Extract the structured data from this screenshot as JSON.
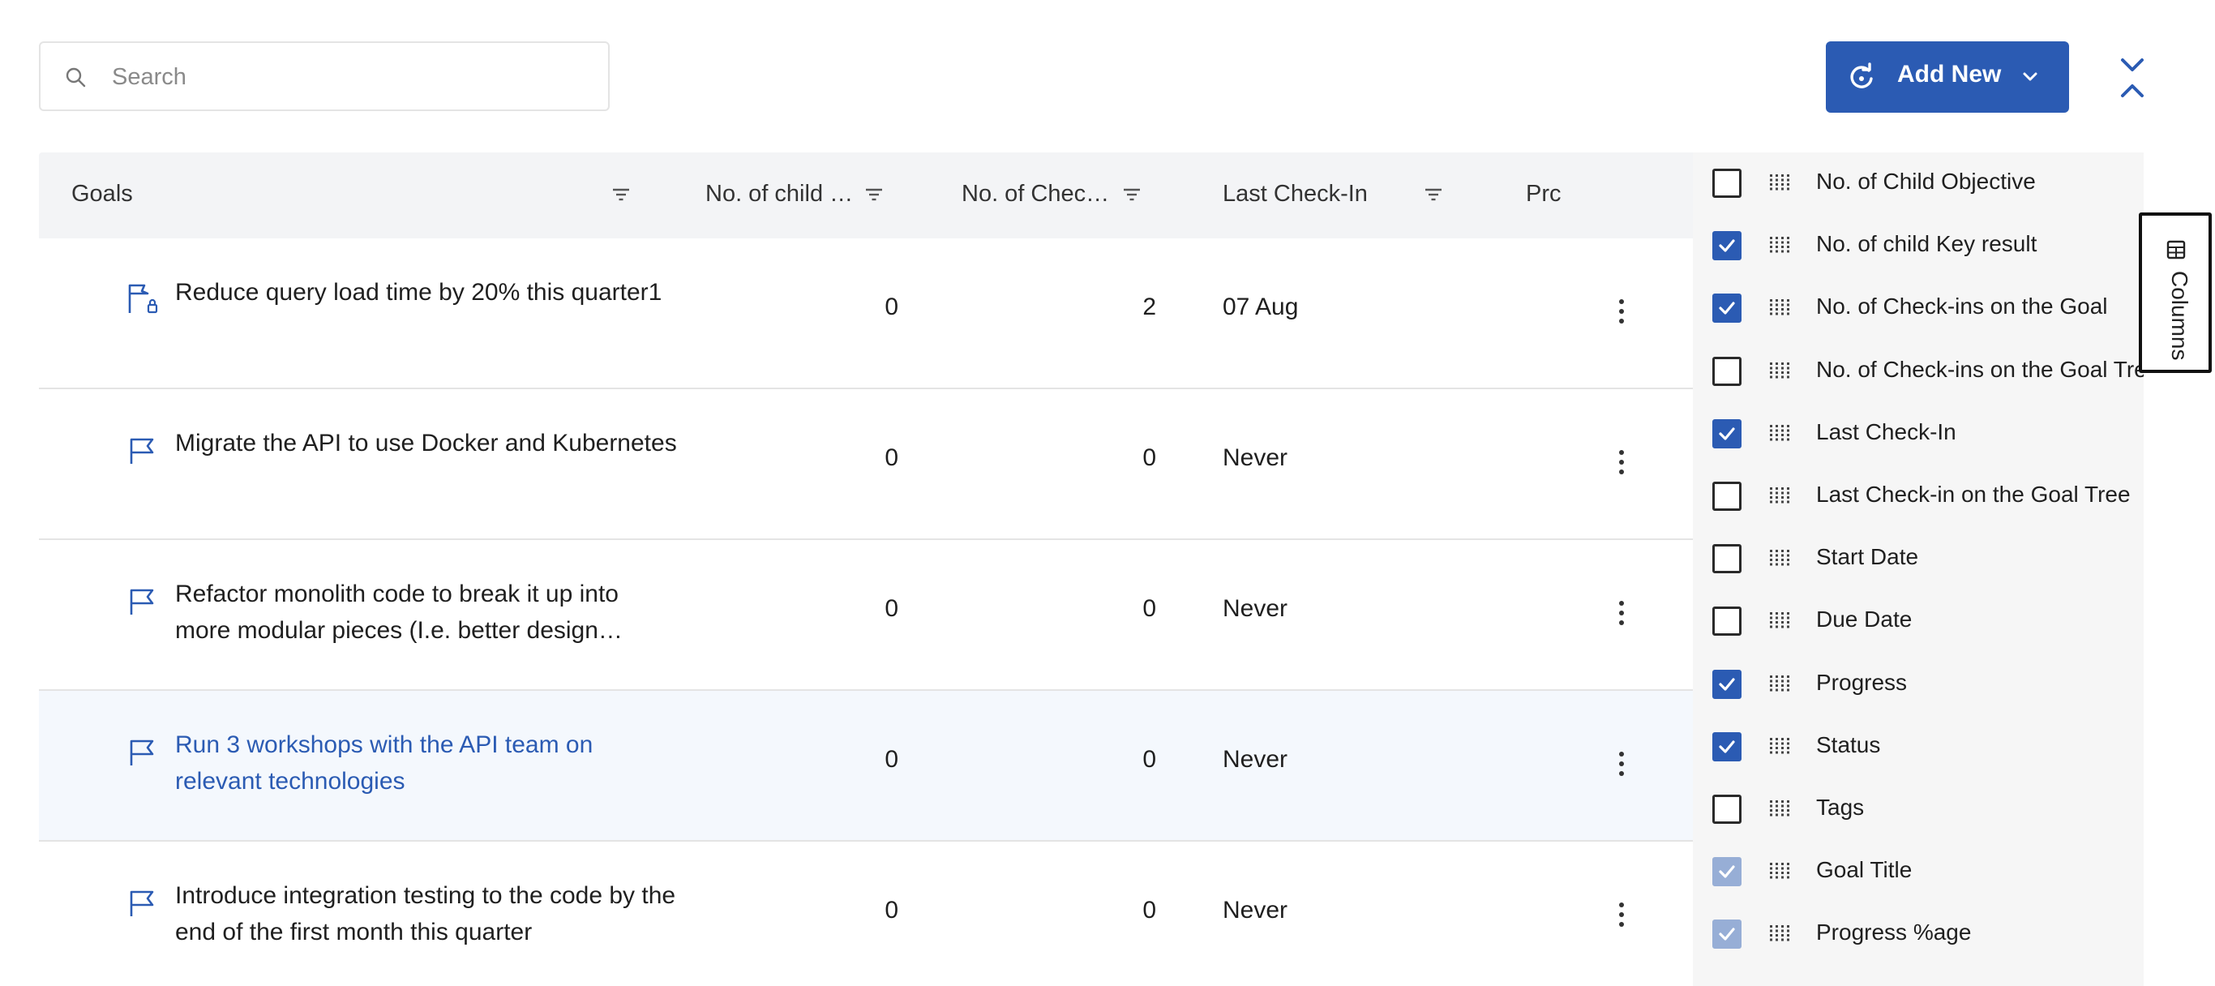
{
  "search": {
    "placeholder": "Search",
    "value": ""
  },
  "toolbar": {
    "add_new_label": "Add New"
  },
  "table": {
    "headers": {
      "goals": "Goals",
      "child": "No. of child …",
      "checkins": "No. of Chec…",
      "last": "Last Check-In",
      "progress": "Prc"
    },
    "rows": [
      {
        "title": "Reduce query load time by 20% this quarter1",
        "child": "0",
        "checkins": "2",
        "last": "07 Aug",
        "locked": true
      },
      {
        "title": "Migrate the API to use Docker and Kubernetes",
        "child": "0",
        "checkins": "0",
        "last": "Never",
        "locked": false
      },
      {
        "title": "Refactor monolith code to break it up into more modular pieces (I.e. better design…",
        "child": "0",
        "checkins": "0",
        "last": "Never",
        "locked": false
      },
      {
        "title": "Run 3 workshops with the API team on relevant technologies",
        "child": "0",
        "checkins": "0",
        "last": "Never",
        "locked": false,
        "hovered": true
      },
      {
        "title": "Introduce integration testing to the code by the end of the first month this quarter",
        "child": "0",
        "checkins": "0",
        "last": "Never",
        "locked": false
      }
    ]
  },
  "columns_panel": {
    "tab_label": "Columns",
    "items": [
      {
        "label": "No. of Child Objective",
        "checked": false
      },
      {
        "label": "No. of child Key result",
        "checked": true
      },
      {
        "label": "No. of Check-ins on the Goal",
        "checked": true
      },
      {
        "label": "No. of Check-ins on the Goal Tree",
        "checked": false
      },
      {
        "label": "Last Check-In",
        "checked": true
      },
      {
        "label": "Last Check-in on the Goal Tree",
        "checked": false
      },
      {
        "label": "Start Date",
        "checked": false
      },
      {
        "label": "Due Date",
        "checked": false
      },
      {
        "label": "Progress",
        "checked": true
      },
      {
        "label": "Status",
        "checked": true
      },
      {
        "label": "Tags",
        "checked": false
      },
      {
        "label": "Goal Title",
        "checked": true,
        "disabled": true
      },
      {
        "label": "Progress %age",
        "checked": true,
        "disabled": true
      }
    ]
  },
  "colors": {
    "accent": "#2b5bb3",
    "header_bg": "#f3f4f6",
    "panel_bg": "#f6f6f6",
    "hover_row": "#f4f8fd"
  }
}
